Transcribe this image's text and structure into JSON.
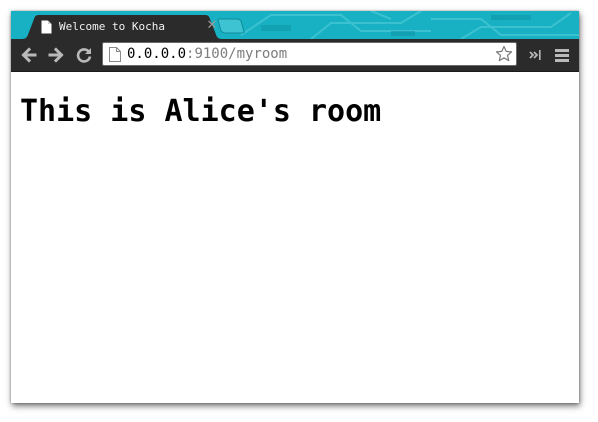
{
  "tab": {
    "title": "Welcome to Kocha",
    "close_glyph": "✕"
  },
  "omnibox": {
    "url_host": "0.0.0.0",
    "url_rest": ":9100/myroom"
  },
  "page": {
    "heading": "This is Alice's room"
  },
  "icons": {
    "tab_favicon": "page-icon",
    "back": "arrow-left-icon",
    "forward": "arrow-right-icon",
    "reload": "reload-icon",
    "bookmark": "star-icon",
    "extensions": "chevron-double-right-icon",
    "menu": "hamburger-menu-icon"
  },
  "colors": {
    "theme": "#17b1c3",
    "tab_bg": "#2b2b2b",
    "toolbar_bg": "#2b2b2b",
    "url_host": "#000000",
    "url_path": "#7d7d7d"
  }
}
